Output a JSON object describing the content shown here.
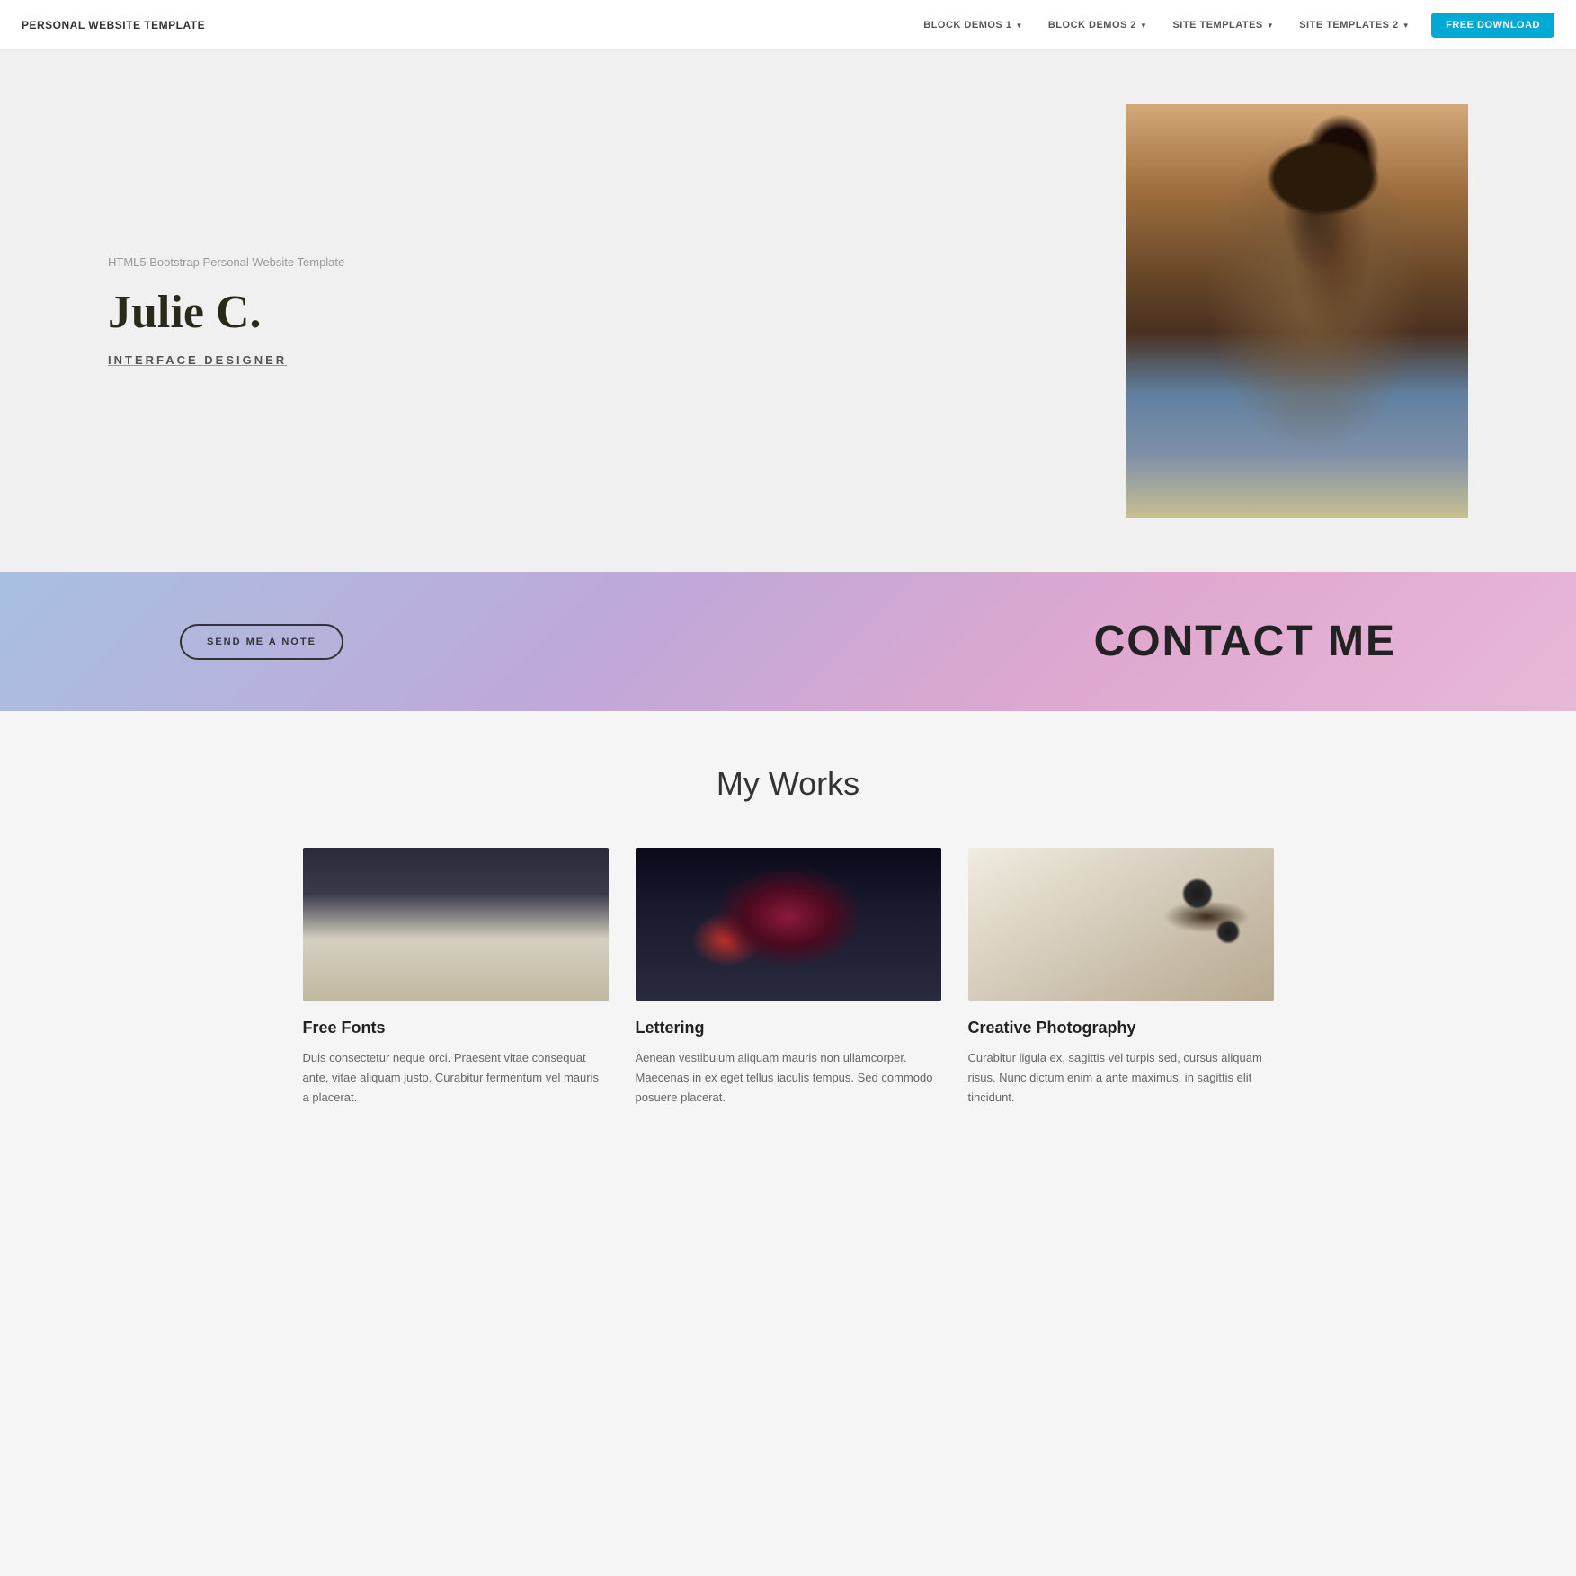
{
  "navbar": {
    "brand": "PERSONAL WEBSITE TEMPLATE",
    "links": [
      {
        "label": "BLOCK DEMOS 1",
        "dropdown": true
      },
      {
        "label": "BLOCK DEMOS 2",
        "dropdown": true
      },
      {
        "label": "SITE TEMPLATES",
        "dropdown": true
      },
      {
        "label": "SITE TEMPLATES 2",
        "dropdown": true
      }
    ],
    "cta": "FREE DOWNLOAD"
  },
  "hero": {
    "subtitle": "HTML5 Bootstrap Personal Website Template",
    "name": "Julie C.",
    "role_prefix": "INT",
    "role_suffix": "ERFACE DESIGNER"
  },
  "contact": {
    "button": "SEND ME A NOTE",
    "title": "CONTACT ME"
  },
  "works": {
    "title": "My Works",
    "items": [
      {
        "title": "Free Fonts",
        "text": "Duis consectetur neque orci. Praesent vitae consequat ante, vitae aliquam justo. Curabitur fermentum vel mauris a placerat."
      },
      {
        "title": "Lettering",
        "text": "Aenean vestibulum aliquam mauris non ullamcorper. Maecenas in ex eget tellus iaculis tempus. Sed commodo posuere placerat."
      },
      {
        "title": "Creative Photography",
        "text": "Curabitur ligula ex, sagittis vel turpis sed, cursus aliquam risus. Nunc dictum enim a ante maximus, in sagittis elit tincidunt."
      }
    ]
  }
}
